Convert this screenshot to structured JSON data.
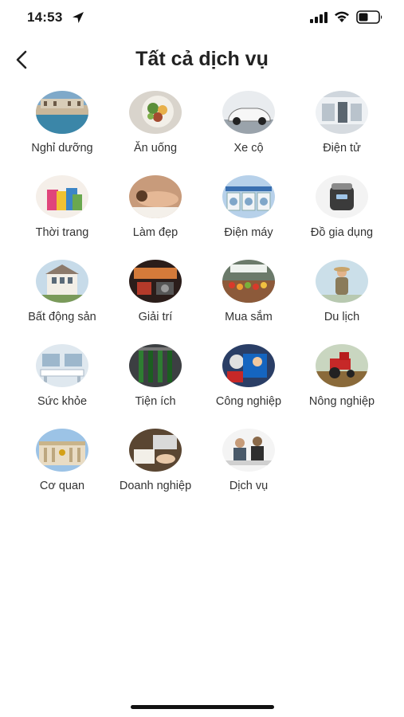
{
  "status_bar": {
    "time": "14:53",
    "icons": [
      "location-arrow-icon",
      "cellular-signal-icon",
      "wifi-icon",
      "battery-icon"
    ]
  },
  "header": {
    "back_icon": "chevron-left-icon",
    "title": "Tất cả dịch vụ"
  },
  "services": [
    {
      "label": "Nghỉ dưỡng"
    },
    {
      "label": "Ăn uống"
    },
    {
      "label": "Xe cộ"
    },
    {
      "label": "Điện tử"
    },
    {
      "label": "Thời trang"
    },
    {
      "label": "Làm đẹp"
    },
    {
      "label": "Điện máy"
    },
    {
      "label": "Đồ gia dụng"
    },
    {
      "label": "Bất động sản"
    },
    {
      "label": "Giải trí"
    },
    {
      "label": "Mua sắm"
    },
    {
      "label": "Du lịch"
    },
    {
      "label": "Sức khỏe"
    },
    {
      "label": "Tiện ích"
    },
    {
      "label": "Công nghiệp"
    },
    {
      "label": "Nông nghiệp"
    },
    {
      "label": "Cơ quan"
    },
    {
      "label": "Doanh nghiệp"
    },
    {
      "label": "Dịch vụ"
    }
  ]
}
